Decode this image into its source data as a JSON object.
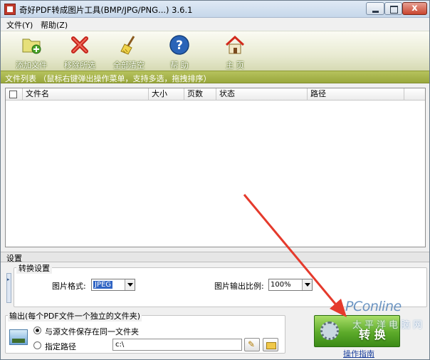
{
  "window": {
    "title": "奇好PDF转成图片工具(BMP/JPG/PNG...) 3.6.1",
    "close_symbol": "x"
  },
  "menu": {
    "file": "文件(Y)",
    "help": "帮助(Z)"
  },
  "toolbar": {
    "add_file": "添加文件",
    "remove_selected": "移除所选",
    "clear_all": "全部清空",
    "help": "帮 助",
    "home": "主 页"
  },
  "file_list": {
    "header": "文件列表 （鼠标右键弹出操作菜单，支持多选，拖拽排序）",
    "columns": [
      "文件名",
      "大小",
      "页数",
      "状态",
      "路径"
    ]
  },
  "settings": {
    "title": "设置",
    "convert_group": "转换设置",
    "format_label": "图片格式:",
    "format_value": "JPEG",
    "ratio_label": "图片输出比例:",
    "ratio_value": "100%"
  },
  "output": {
    "legend": "输出(每个PDF文件一个独立的文件夹)",
    "option_same_folder": "与源文件保存在同一文件夹",
    "option_custom_path": "指定路径",
    "path_value": "c:\\"
  },
  "convert": {
    "button_label": "转 换",
    "guide_link": "操作指南"
  },
  "watermark": {
    "main": "PConline",
    "sub": "太平洋电脑网"
  },
  "colors": {
    "accent_green": "#5caa2a",
    "header_olive": "#9aa83d",
    "arrow_red": "#e53a2c"
  }
}
